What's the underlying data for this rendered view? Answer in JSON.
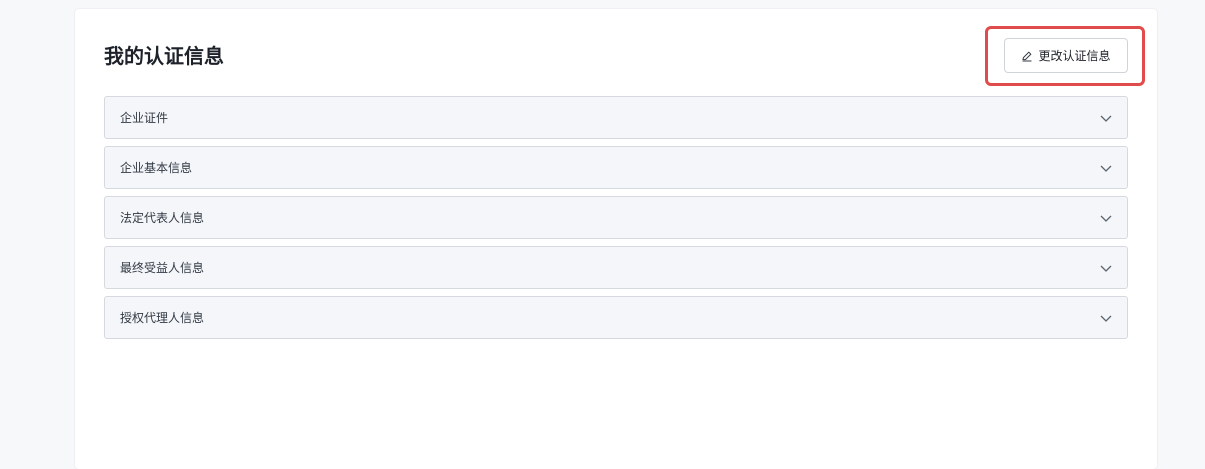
{
  "page": {
    "title": "我的认证信息",
    "edit_button_label": "更改认证信息"
  },
  "icons": {
    "edit": "edit-pen-icon",
    "expand": "chevron-down-icon"
  },
  "colors": {
    "highlight": "#e04b4b",
    "section_bg": "#f4f6f9"
  },
  "sections": [
    {
      "label": "企业证件"
    },
    {
      "label": "企业基本信息"
    },
    {
      "label": "法定代表人信息"
    },
    {
      "label": "最终受益人信息"
    },
    {
      "label": "授权代理人信息"
    }
  ]
}
